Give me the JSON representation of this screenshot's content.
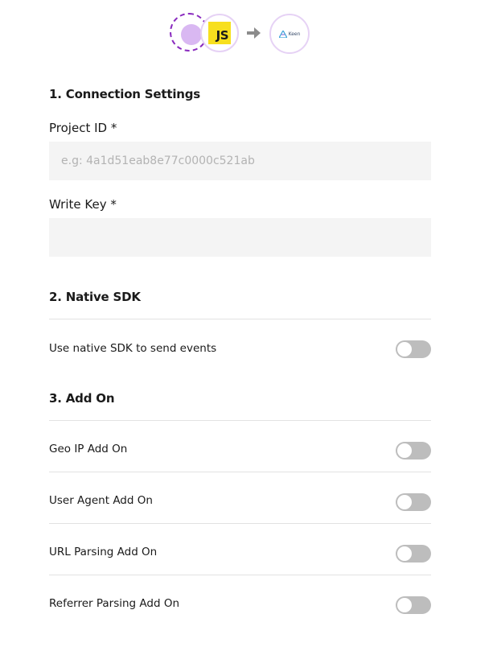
{
  "flow": {
    "source_icon": "source-placeholder-icon",
    "js_badge": "JS",
    "arrow_icon": "arrow-right-icon",
    "destination_logo_text": "Keen"
  },
  "sections": {
    "connection": {
      "title": "1. Connection Settings",
      "project_id_label": "Project ID *",
      "project_id_placeholder": "e.g: 4a1d51eab8e77c0000c521ab",
      "project_id_value": "",
      "write_key_label": "Write Key *",
      "write_key_value": ""
    },
    "native_sdk": {
      "title": "2. Native SDK",
      "items": [
        {
          "label": "Use native SDK to send events",
          "enabled": false
        }
      ]
    },
    "add_on": {
      "title": "3. Add On",
      "items": [
        {
          "label": "Geo IP Add On",
          "enabled": false
        },
        {
          "label": "User Agent Add On",
          "enabled": false
        },
        {
          "label": "URL Parsing Add On",
          "enabled": false
        },
        {
          "label": "Referrer Parsing Add On",
          "enabled": false
        }
      ]
    }
  },
  "colors": {
    "accent_purple": "#8a2bbf",
    "js_yellow": "#f7df1e",
    "toggle_off": "#bdbdbd",
    "input_bg": "#f4f4f4"
  }
}
